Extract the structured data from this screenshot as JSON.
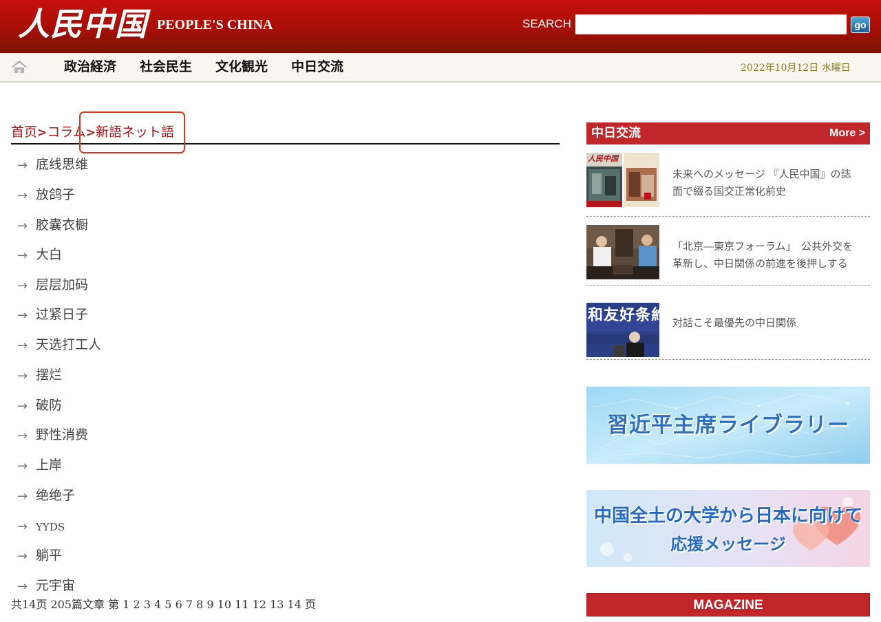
{
  "header": {
    "logo_cn": "人民中国",
    "logo_en": "PEOPLE'S CHINA",
    "search_label": "SEARCH",
    "search_value": "",
    "go_label": "go"
  },
  "nav": {
    "items": [
      "政治経済",
      "社会民生",
      "文化観光",
      "中日交流"
    ],
    "date": "2022年10月12日 水曜日"
  },
  "breadcrumb": {
    "home": "首页",
    "sep": ">",
    "column": "コラム",
    "current": "新語ネット語"
  },
  "list": {
    "arrow": "→",
    "items": [
      "底线思维",
      "放鸽子",
      "胶囊衣橱",
      "大白",
      "层层加码",
      "过紧日子",
      "天选打工人",
      "摆烂",
      "破防",
      "野性消费",
      "上岸",
      "绝绝子",
      "YYDS",
      "躺平",
      "元宇宙"
    ]
  },
  "pager": {
    "prefix": "共14页 205篇文章 第",
    "pages": [
      "1",
      "2",
      "3",
      "4",
      "5",
      "6",
      "7",
      "8",
      "9",
      "10",
      "11",
      "12",
      "13",
      "14"
    ],
    "suffix": "页"
  },
  "sidebar": {
    "section_title": "中日交流",
    "more": "More >",
    "news": [
      {
        "title": "未来へのメッセージ 『人民中国』の誌面で綴る国交正常化前史"
      },
      {
        "title": "「北京―東京フォーラム」　公共外交を革新し、中日関係の前進を後押しする"
      },
      {
        "title": "対話こそ最優先の中日関係"
      }
    ],
    "banner1": "習近平主席ライブラリー",
    "banner2_line1": "中国全土の大学から日本に向けて",
    "banner2_line2": "応援メッセージ",
    "magazine": "MAGAZINE"
  },
  "thumb_text": {
    "t1": "人民中国",
    "t3": "和友好条約"
  },
  "colors": {
    "header_red": "#c70f0b",
    "accent_red": "#c1262b",
    "link_red": "#b0141b",
    "date_olive": "#8a7a23"
  }
}
